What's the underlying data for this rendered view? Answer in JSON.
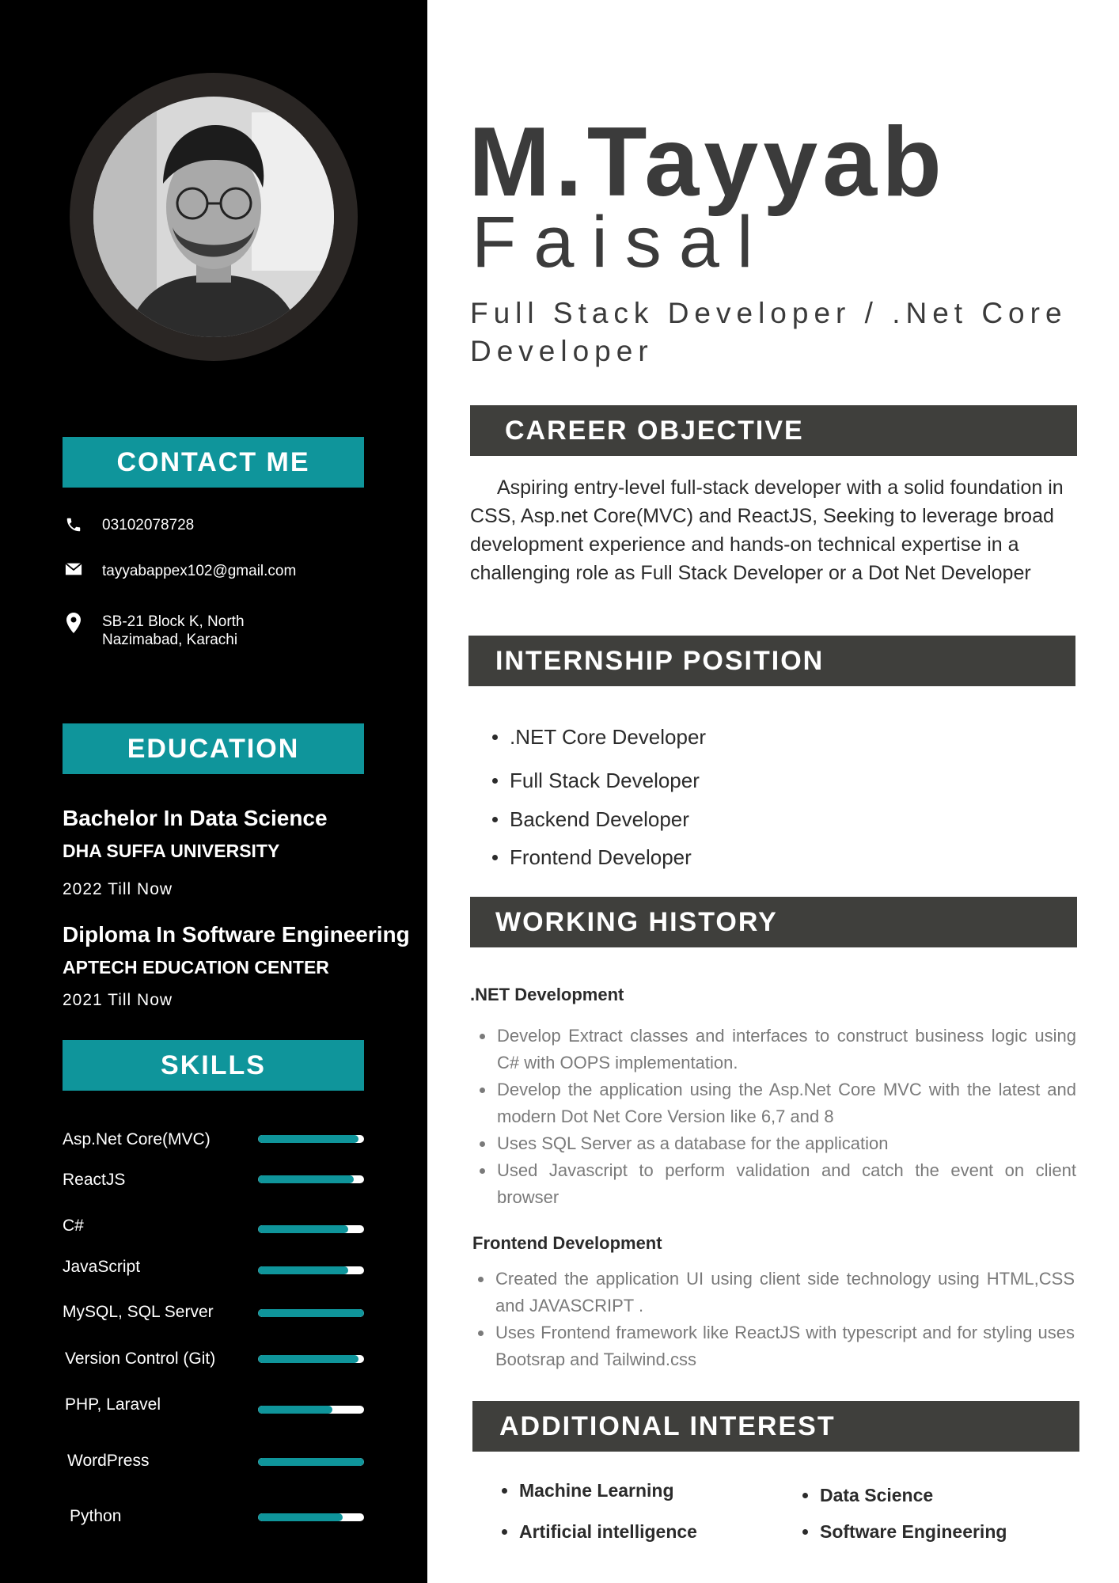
{
  "profile": {
    "first_name": "M.Tayyab",
    "last_name": "Faisal",
    "role": "Full Stack Developer / .Net Core Developer"
  },
  "contact": {
    "heading": "CONTACT ME",
    "phone": "03102078728",
    "email": "tayyabappex102@gmail.com",
    "address_line1": "SB-21 Block K, North",
    "address_line2": "Nazimabad, Karachi"
  },
  "education": {
    "heading": "EDUCATION",
    "items": [
      {
        "degree": "Bachelor In Data Science",
        "school": "DHA SUFFA UNIVERSITY",
        "years": "2022 Till Now"
      },
      {
        "degree": "Diploma In Software Engineering",
        "school": "APTECH EDUCATION CENTER",
        "years": "2021 Till Now"
      }
    ]
  },
  "skills": {
    "heading": "SKILLS",
    "items": [
      {
        "name": "Asp.Net Core(MVC)",
        "level": 0.95
      },
      {
        "name": "ReactJS",
        "level": 0.9
      },
      {
        "name": "C#",
        "level": 0.85
      },
      {
        "name": "JavaScript",
        "level": 0.85
      },
      {
        "name": "MySQL, SQL Server",
        "level": 1.0
      },
      {
        "name": "Version Control (Git)",
        "level": 0.95
      },
      {
        "name": "PHP, Laravel",
        "level": 0.7
      },
      {
        "name": "WordPress",
        "level": 1.0
      },
      {
        "name": "Python",
        "level": 0.8
      }
    ]
  },
  "career": {
    "heading": "CAREER OBJECTIVE",
    "text": "Aspiring entry-level full-stack developer with a solid foundation in CSS, Asp.net Core(MVC) and ReactJS, Seeking to leverage broad development experience and hands-on technical expertise in a challenging role as Full Stack Developer or a Dot Net Developer"
  },
  "internship": {
    "heading": "INTERNSHIP POSITION",
    "items": [
      ".NET Core Developer",
      "Full Stack Developer",
      "Backend Developer",
      "Frontend Developer"
    ]
  },
  "work": {
    "heading": "WORKING HISTORY",
    "sections": [
      {
        "title": ".NET Development",
        "items": [
          "Develop Extract classes and interfaces to construct business logic using C# with OOPS implementation.",
          "Develop the application using the Asp.Net Core MVC with the latest and modern Dot Net Core Version like 6,7 and 8",
          "Uses SQL Server as a database for the application",
          "Used Javascript to perform validation and catch the event on client browser"
        ]
      },
      {
        "title": "Frontend Development",
        "items": [
          "Created the application UI using client side technology using HTML,CSS and JAVASCRIPT .",
          "Uses Frontend framework like ReactJS with typescript and for styling uses Bootsrap and Tailwind.css"
        ]
      }
    ]
  },
  "interests": {
    "heading": "ADDITIONAL INTEREST",
    "left": [
      "Machine Learning",
      "Artificial intelligence"
    ],
    "right": [
      "Data Science",
      "Software Engineering"
    ]
  },
  "colors": {
    "sidebar_bg": "#000000",
    "accent_teal": "#0f959b",
    "section_bar": "#3f3f3c",
    "name_text": "#3b3b3b"
  }
}
